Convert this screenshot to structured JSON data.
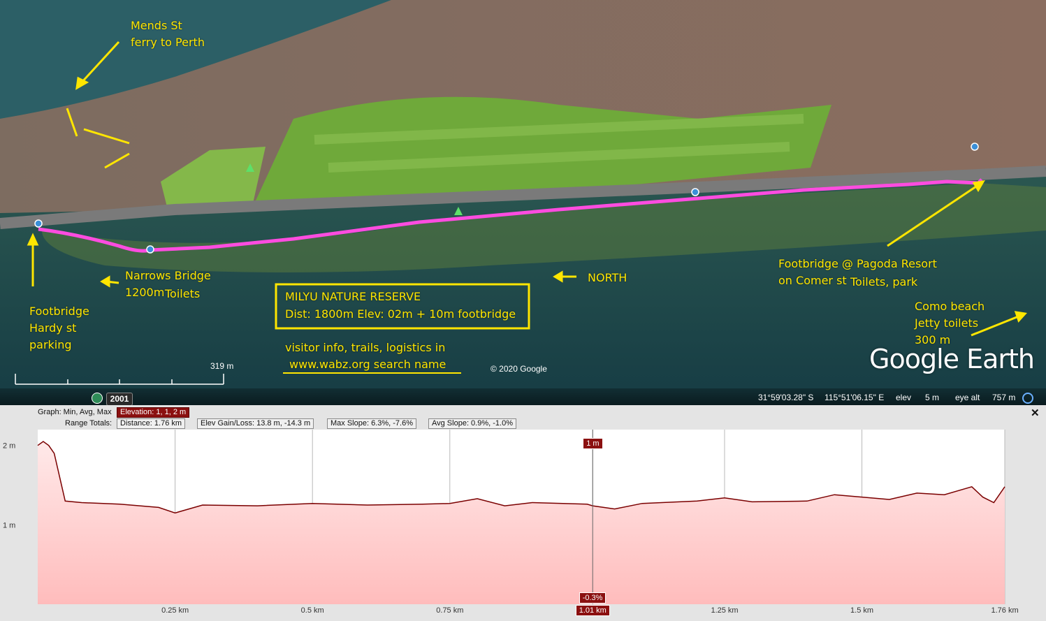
{
  "map": {
    "colors": {
      "water": "#1f5a5f",
      "trail": "#ff4ce0",
      "annotation": "#ffe600",
      "park": "#7fb83a"
    },
    "annotations": {
      "mends_line1": "Mends St",
      "mends_line2": "ferry to Perth",
      "narrows_line1": "Narrows Bridge",
      "narrows_line2": "1200m",
      "narrows_toilets": "Toilets",
      "footbridge_hardy_1": "Footbridge",
      "footbridge_hardy_2": "Hardy st",
      "footbridge_hardy_3": "parking",
      "north": "NORTH",
      "info_title": "MILYU NATURE RESERVE",
      "info_detail": "Dist: 1800m  Elev: 02m + 10m footbridge",
      "visitor_line1": "visitor info, trails, logistics in",
      "visitor_line2": "www.wabz.org search name",
      "pagoda_line1": "Footbridge @ Pagoda Resort",
      "pagoda_line2": "on Comer st",
      "pagoda_toilets": "Toilets, park",
      "como_line1": "Como beach",
      "como_line2": "Jetty toilets",
      "como_line3": "300 m"
    },
    "scale_label": "319 m",
    "copyright": "© 2020 Google",
    "logo": "Google Earth"
  },
  "statusbar": {
    "year": "2001",
    "lat": "31°59'03.28\" S",
    "lon": "115°51'06.15\" E",
    "elev_label": "elev",
    "elev_value": "5 m",
    "eye_alt_label": "eye alt",
    "eye_alt_value": "757 m",
    "icons": [
      "clock-icon",
      "eye-alt-icon"
    ]
  },
  "graph": {
    "header": {
      "graph_label": "Graph: Min, Avg, Max",
      "elevation": "Elevation: 1, 1, 2 m",
      "range_label": "Range Totals:",
      "distance": "Distance: 1.76 km",
      "gain_loss": "Elev Gain/Loss: 13.8 m, -14.3 m",
      "max_slope": "Max Slope: 6.3%, -7.6%",
      "avg_slope": "Avg Slope: 0.9%, -1.0%"
    },
    "cursor": {
      "elev_label": "1 m",
      "slope_label": "-0.3%",
      "dist_label": "1.01 km",
      "dist_km": 1.01
    },
    "colors": {
      "line": "#7a0000",
      "fill_top": "#ffe9e9",
      "fill_bottom": "#ffbcbc"
    }
  },
  "chart_data": {
    "type": "area",
    "x_unit": "km",
    "y_unit": "m",
    "xlim": [
      0,
      1.76
    ],
    "ylim": [
      0,
      2.2
    ],
    "xticks": [
      0.25,
      0.5,
      0.75,
      1.01,
      1.25,
      1.5,
      1.76
    ],
    "xtick_labels": [
      "0.25 km",
      "0.5 km",
      "0.75 km",
      "1.01 km",
      "1.25 km",
      "1.5 km",
      "1.76 km"
    ],
    "yticks": [
      1,
      2
    ],
    "ytick_labels": [
      "1 m",
      "2 m"
    ],
    "x": [
      0,
      0.01,
      0.02,
      0.03,
      0.05,
      0.08,
      0.15,
      0.22,
      0.25,
      0.3,
      0.4,
      0.5,
      0.6,
      0.7,
      0.75,
      0.8,
      0.85,
      0.9,
      1.0,
      1.01,
      1.05,
      1.1,
      1.2,
      1.25,
      1.3,
      1.4,
      1.45,
      1.5,
      1.55,
      1.6,
      1.65,
      1.7,
      1.72,
      1.74,
      1.76
    ],
    "y": [
      2.0,
      2.05,
      2.0,
      1.9,
      1.3,
      1.28,
      1.26,
      1.22,
      1.15,
      1.25,
      1.24,
      1.27,
      1.25,
      1.26,
      1.27,
      1.33,
      1.24,
      1.28,
      1.26,
      1.24,
      1.2,
      1.27,
      1.3,
      1.34,
      1.29,
      1.3,
      1.38,
      1.35,
      1.32,
      1.4,
      1.38,
      1.48,
      1.35,
      1.28,
      1.48
    ],
    "grid": true
  }
}
